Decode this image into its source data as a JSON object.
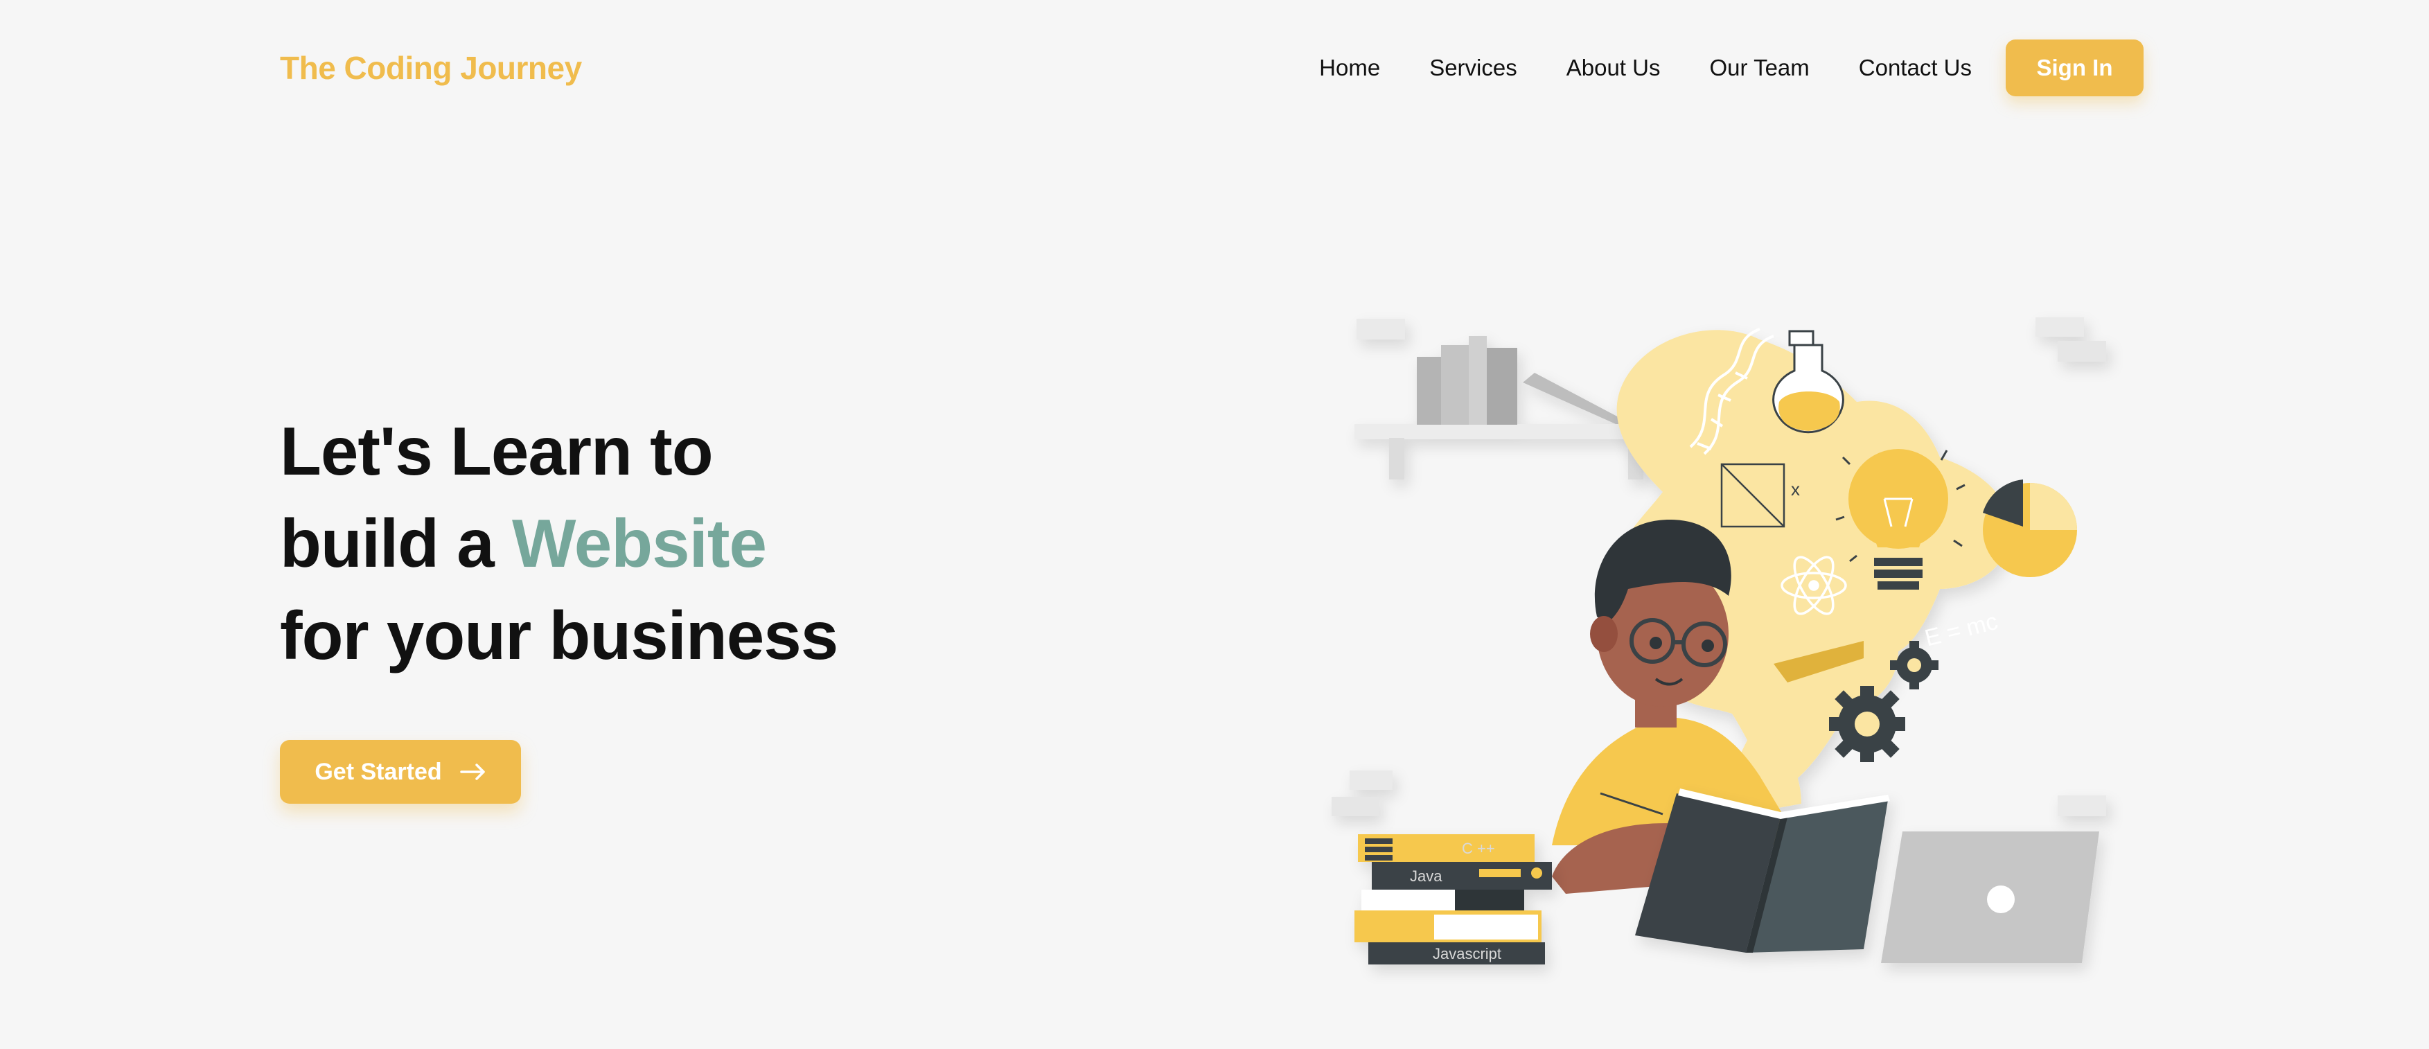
{
  "header": {
    "logo": "The Coding Journey",
    "nav": [
      "Home",
      "Services",
      "About Us",
      "Our Team",
      "Contact Us"
    ],
    "signin_label": "Sign In"
  },
  "hero": {
    "line1": "Let's Learn to",
    "line2_prefix": "build a ",
    "line2_accent": "Website",
    "line3": "for your business",
    "cta_label": "Get Started"
  },
  "illustration": {
    "books": [
      "C ++",
      "Java",
      "Javascript"
    ],
    "formula": "E = mc",
    "x_mark": "x"
  },
  "colors": {
    "brand": "#f0bc4d",
    "accent": "#76a79b",
    "background": "#f6f6f6",
    "text": "#111111"
  },
  "icons": [
    "arrow-right-icon",
    "lightbulb-icon",
    "flask-icon",
    "dna-icon",
    "atom-icon",
    "gear-icon",
    "pie-chart-icon",
    "laptop-icon"
  ]
}
